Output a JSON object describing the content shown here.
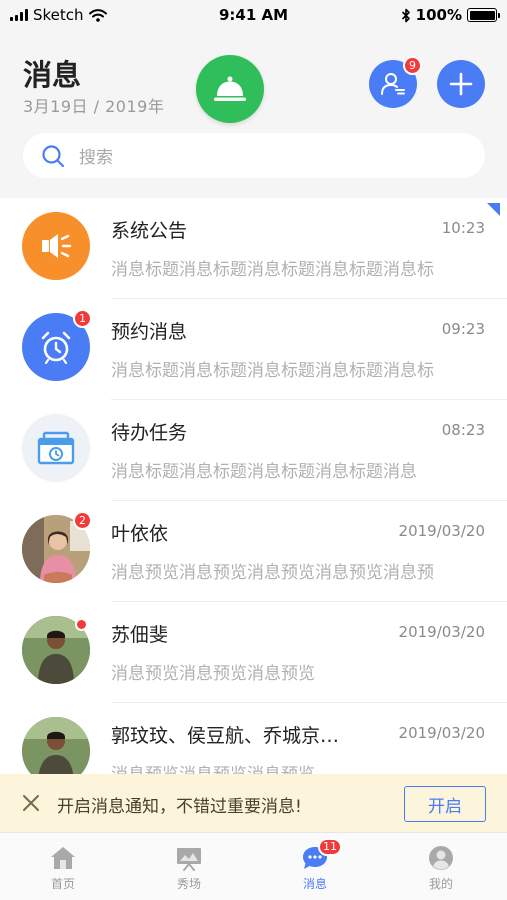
{
  "status_bar": {
    "carrier": "Sketch",
    "time": "9:41 AM",
    "battery": "100%",
    "battery_level": 1.0
  },
  "header": {
    "title": "消息",
    "date": "3月19日 / 2019年",
    "center_icon": "cloche-icon",
    "contacts_badge": "9",
    "contacts_icon": "contacts-icon",
    "add_icon": "plus-icon"
  },
  "search": {
    "placeholder": "搜索"
  },
  "messages": [
    {
      "title": "系统公告",
      "time": "10:23",
      "preview": "消息标题消息标题消息标题消息标题消息标",
      "avatar": "megaphone-icon",
      "avatar_color": "#f7902a",
      "pinned": true
    },
    {
      "title": "预约消息",
      "time": "09:23",
      "preview": "消息标题消息标题消息标题消息标题消息标",
      "avatar": "alarm-clock-icon",
      "avatar_color": "#4a7cf6",
      "badge": "1"
    },
    {
      "title": "待办任务",
      "time": "08:23",
      "preview": "消息标题消息标题消息标题消息标题消息",
      "avatar": "todo-box-icon",
      "avatar_color": "#eef1f5"
    },
    {
      "title": "叶依依",
      "time": "2019/03/20",
      "preview": "消息预览消息预览消息预览消息预览消息预",
      "avatar": "user-photo",
      "badge": "2"
    },
    {
      "title": "苏佃斐",
      "time": "2019/03/20",
      "preview": "消息预览消息预览消息预览",
      "avatar": "user-photo",
      "dot": true
    },
    {
      "title": "郭玟玟、侯豆航、乔城京…",
      "time": "2019/03/20",
      "preview": "消息预览消息预览消息预览",
      "avatar": "user-photo"
    }
  ],
  "notice": {
    "text": "开启消息通知，不错过重要消息!",
    "button": "开启"
  },
  "tabs": [
    {
      "label": "首页",
      "icon": "home-icon",
      "active": false
    },
    {
      "label": "秀场",
      "icon": "showroom-icon",
      "active": false
    },
    {
      "label": "消息",
      "icon": "chat-icon",
      "active": true,
      "badge": "11"
    },
    {
      "label": "我的",
      "icon": "profile-icon",
      "active": false
    }
  ],
  "colors": {
    "accent": "#4a7cf6",
    "green": "#2fbe5a",
    "orange": "#f7902a",
    "badge_red": "#f23a3a",
    "notice_bg": "#fdf4dc"
  }
}
